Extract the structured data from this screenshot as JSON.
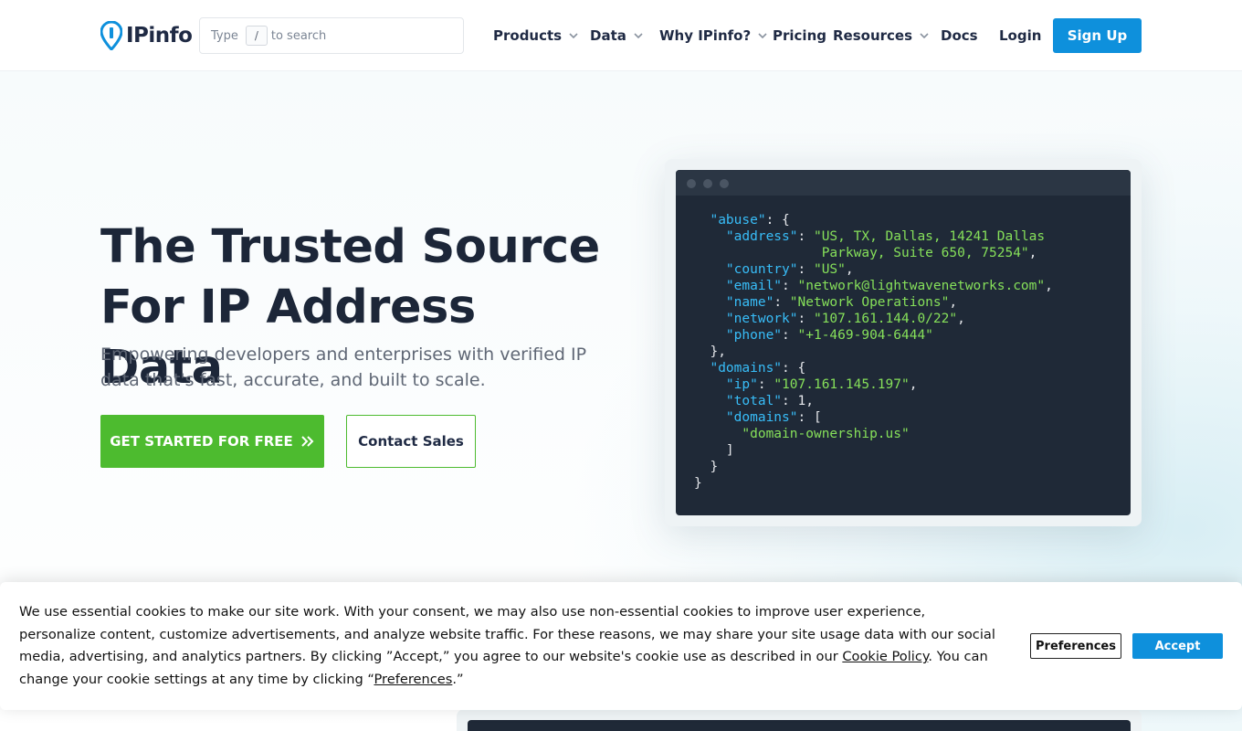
{
  "header": {
    "logo_text": "IPinfo",
    "search": {
      "prefix": "Type",
      "key": "/",
      "suffix": "to search"
    },
    "nav": [
      {
        "label": "Products",
        "has_dropdown": true
      },
      {
        "label": "Data",
        "has_dropdown": true
      },
      {
        "label": "Why IPinfo?",
        "has_dropdown": true
      },
      {
        "label": "Pricing",
        "has_dropdown": false
      },
      {
        "label": "Resources",
        "has_dropdown": true
      },
      {
        "label": "Docs",
        "has_dropdown": false
      },
      {
        "label": "Login",
        "has_dropdown": false
      }
    ],
    "signup_label": "Sign Up"
  },
  "hero": {
    "title_line1": "The Trusted Source",
    "title_line2": "For IP Address Data",
    "subtitle": "Empowering developers and enterprises with verified IP data that's fast, accurate, and built to scale.",
    "cta_primary": "GET STARTED FOR FREE",
    "cta_secondary": "Contact Sales"
  },
  "code": {
    "abuse_key": "\"abuse\"",
    "address_key": "\"address\"",
    "address_val_1": "\"US, TX, Dallas, 14241 Dallas",
    "address_val_2": "Parkway, Suite 650, 75254\"",
    "country_key": "\"country\"",
    "country_val": "\"US\"",
    "email_key": "\"email\"",
    "email_val": "\"network@lightwavenetworks.com\"",
    "name_key": "\"name\"",
    "name_val": "\"Network Operations\"",
    "network_key": "\"network\"",
    "network_val": "\"107.161.144.0/22\"",
    "phone_key": "\"phone\"",
    "phone_val": "\"+1-469-904-6444\"",
    "domains_key": "\"domains\"",
    "ip_key": "\"ip\"",
    "ip_val": "\"107.161.145.197\"",
    "total_key": "\"total\"",
    "total_val": "1",
    "domains_list_key": "\"domains\"",
    "domain_item": "\"domain-ownership.us\""
  },
  "cookie": {
    "text_1": "We use essential cookies to make our site work. With your consent, we may also use non-essential cookies to improve user experience, personalize content, customize advertisements, and analyze website traffic. For these reasons, we may share your site usage data with our social media, advertising, and analytics partners. By clicking ”Accept,” you agree to our website's cookie use as described in our ",
    "policy_link": "Cookie Policy",
    "text_2": ". You can change your cookie settings at any time by clicking “",
    "preferences_link": "Preferences",
    "text_3": ".”",
    "preferences_button": "Preferences",
    "accept_button": "Accept"
  },
  "colors": {
    "brand_blue": "#0e90dc",
    "cta_green": "#4dbb2f",
    "code_bg": "#1f2937",
    "code_key": "#38bdf8",
    "code_string": "#86e05a"
  }
}
